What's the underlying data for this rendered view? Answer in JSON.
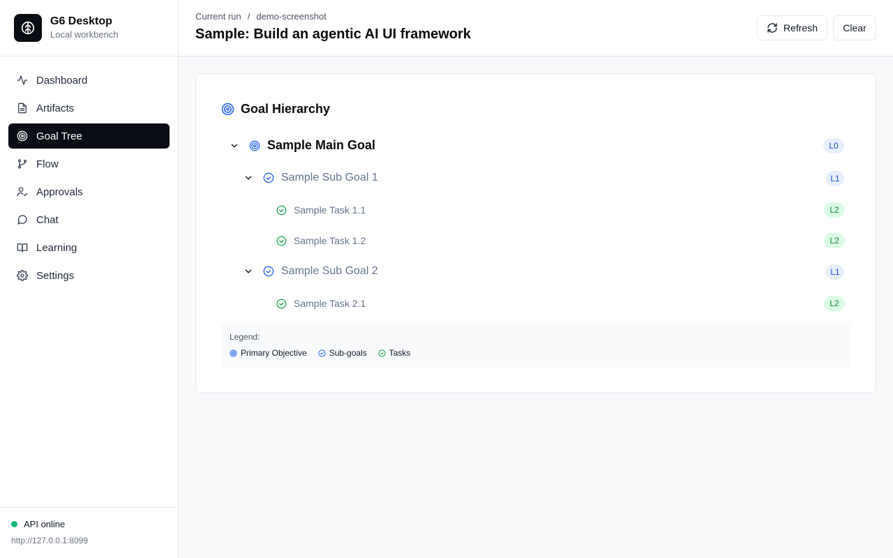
{
  "app": {
    "title": "G6 Desktop",
    "subtitle": "Local workbench"
  },
  "sidebar": {
    "items": [
      {
        "label": "Dashboard",
        "icon": "activity-icon",
        "active": false
      },
      {
        "label": "Artifacts",
        "icon": "file-text-icon",
        "active": false
      },
      {
        "label": "Goal Tree",
        "icon": "target-icon",
        "active": true
      },
      {
        "label": "Flow",
        "icon": "git-branch-icon",
        "active": false
      },
      {
        "label": "Approvals",
        "icon": "user-check-icon",
        "active": false
      },
      {
        "label": "Chat",
        "icon": "message-circle-icon",
        "active": false
      },
      {
        "label": "Learning",
        "icon": "book-open-icon",
        "active": false
      },
      {
        "label": "Settings",
        "icon": "gear-icon",
        "active": false
      }
    ],
    "footer": {
      "status": "API online",
      "status_color": "#10b981",
      "url": "http://127.0.0.1:8099"
    }
  },
  "header": {
    "breadcrumb": {
      "first": "Current run",
      "separator": "/",
      "second": "demo-screenshot"
    },
    "title": "Sample: Build an agentic AI UI framework",
    "refresh_label": "Refresh",
    "clear_label": "Clear"
  },
  "goal_tree": {
    "title": "Goal Hierarchy",
    "main": {
      "label": "Sample Main Goal",
      "level": "L0"
    },
    "sub1": {
      "label": "Sample Sub Goal 1",
      "level": "L1"
    },
    "task11": {
      "label": "Sample Task 1.1",
      "level": "L2"
    },
    "task12": {
      "label": "Sample Task 1.2",
      "level": "L2"
    },
    "sub2": {
      "label": "Sample Sub Goal 2",
      "level": "L1"
    },
    "task21": {
      "label": "Sample Task 2.1",
      "level": "L2"
    },
    "legend": {
      "title": "Legend:",
      "primary": "Primary Objective",
      "subgoals": "Sub-goals",
      "tasks": "Tasks"
    }
  },
  "colors": {
    "accent_blue": "#2563eb",
    "task_green": "#16a34a",
    "active_nav": "#0b0d14"
  }
}
